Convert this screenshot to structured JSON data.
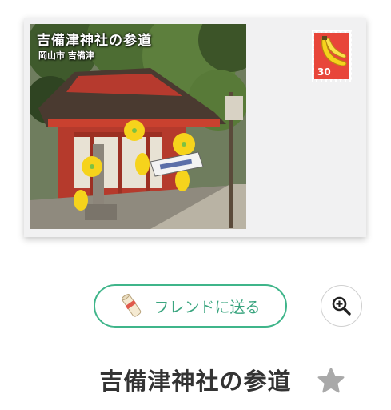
{
  "postcard": {
    "photo_title": "吉備津神社の参道",
    "photo_location": "岡山市 吉備津",
    "stamp": {
      "value": "30",
      "icon": "banana-icon",
      "color": "#e8463a"
    }
  },
  "actions": {
    "send_label": "フレンドに送る",
    "send_icon": "scroll-icon",
    "zoom_icon": "zoom-in-icon",
    "accent_color": "#3aa57f"
  },
  "title": "吉備津神社の参道",
  "favorite": {
    "icon": "star-icon",
    "active": false
  }
}
